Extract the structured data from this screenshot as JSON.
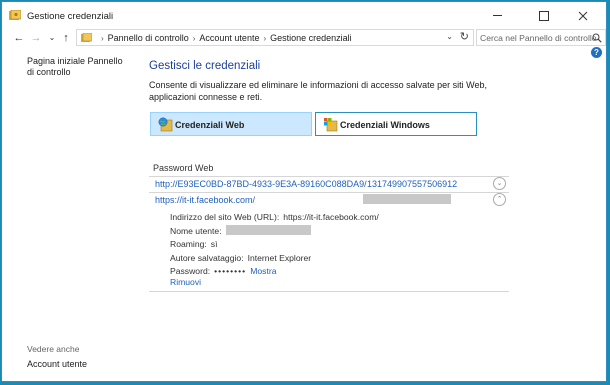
{
  "window": {
    "title": "Gestione credenziali",
    "minimize_icon": "minimize-icon",
    "maximize_icon": "maximize-icon",
    "close_icon": "close-icon"
  },
  "address": {
    "breadcrumbs": [
      "Pannello di controllo",
      "Account utente",
      "Gestione credenziali"
    ],
    "search_placeholder": "Cerca nel Pannello di controllo"
  },
  "help": {
    "label": "?"
  },
  "sidebar": {
    "home_link": "Pagina iniziale Pannello di controllo",
    "see_also": "Vedere anche",
    "account_link": "Account utente"
  },
  "main": {
    "heading": "Gestisci le credenziali",
    "intro": "Consente di visualizzare ed eliminare le informazioni di accesso salvate per siti Web, applicazioni connesse e reti.",
    "tabs": [
      {
        "label": "Credenziali Web",
        "selected": true
      },
      {
        "label": "Credenziali Windows",
        "selected": false
      }
    ],
    "section_label": "Password Web",
    "entries": [
      {
        "url": "http://E93EC0BD-87BD-4933-9E3A-89160C088DA9/",
        "value": "131749907557506912",
        "expanded": false
      },
      {
        "url": "https://it-it.facebook.com/",
        "value": "",
        "expanded": true
      }
    ],
    "details": {
      "site_label": "Indirizzo del sito Web (URL):",
      "site_value": "https://it-it.facebook.com/",
      "username_label": "Nome utente:",
      "roaming_label": "Roaming:",
      "roaming_value": "sì",
      "saved_by_label": "Autore salvataggio:",
      "saved_by_value": "Internet Explorer",
      "password_label": "Password:",
      "password_value": "••••••••",
      "show_link": "Mostra",
      "remove_link": "Rimuovi"
    }
  },
  "colors": {
    "frame": "#1b8ab4",
    "heading": "#1d3f99",
    "link": "#1f5fbf",
    "tab_selected_bg": "#cce8ff"
  }
}
